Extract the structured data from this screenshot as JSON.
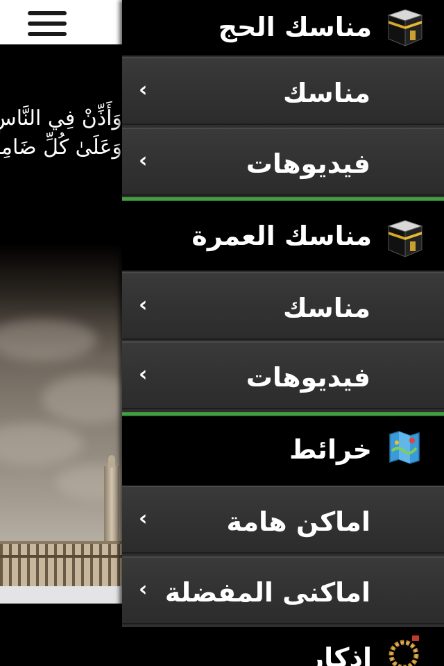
{
  "background_page": {
    "menu_icon": "hamburger-menu-icon",
    "verse_lines": [
      "وَأَذِّنْ فِي النَّاسِ بِالْحَجِّ يَأْتُوكَ رِجَالًا",
      "وَعَلَىٰ كُلِّ ضَامِرٍ يَأْتِينَ مِنْ كُلِّ فَجٍّ عَمِيقٍ"
    ]
  },
  "drawer": {
    "sections": [
      {
        "title": "مناسك الحج",
        "icon": "kaaba-icon",
        "items": [
          {
            "label": "مناسك",
            "chevron": "‹"
          },
          {
            "label": "فيديوهات",
            "chevron": "‹"
          }
        ]
      },
      {
        "title": "مناسك العمرة",
        "icon": "kaaba-icon",
        "items": [
          {
            "label": "مناسك",
            "chevron": "‹"
          },
          {
            "label": "فيديوهات",
            "chevron": "‹"
          }
        ]
      },
      {
        "title": "خرائط",
        "icon": "map-icon",
        "items": [
          {
            "label": "اماكن هامة",
            "chevron": "‹"
          },
          {
            "label": "اماكنى المفضلة",
            "chevron": "‹"
          }
        ]
      },
      {
        "title": "اذكار",
        "icon": "prayer-beads-icon",
        "items": []
      }
    ]
  },
  "colors": {
    "separator_green": "#4aa84a",
    "drawer_item_bg": "#323232",
    "header_bg": "#000000"
  }
}
